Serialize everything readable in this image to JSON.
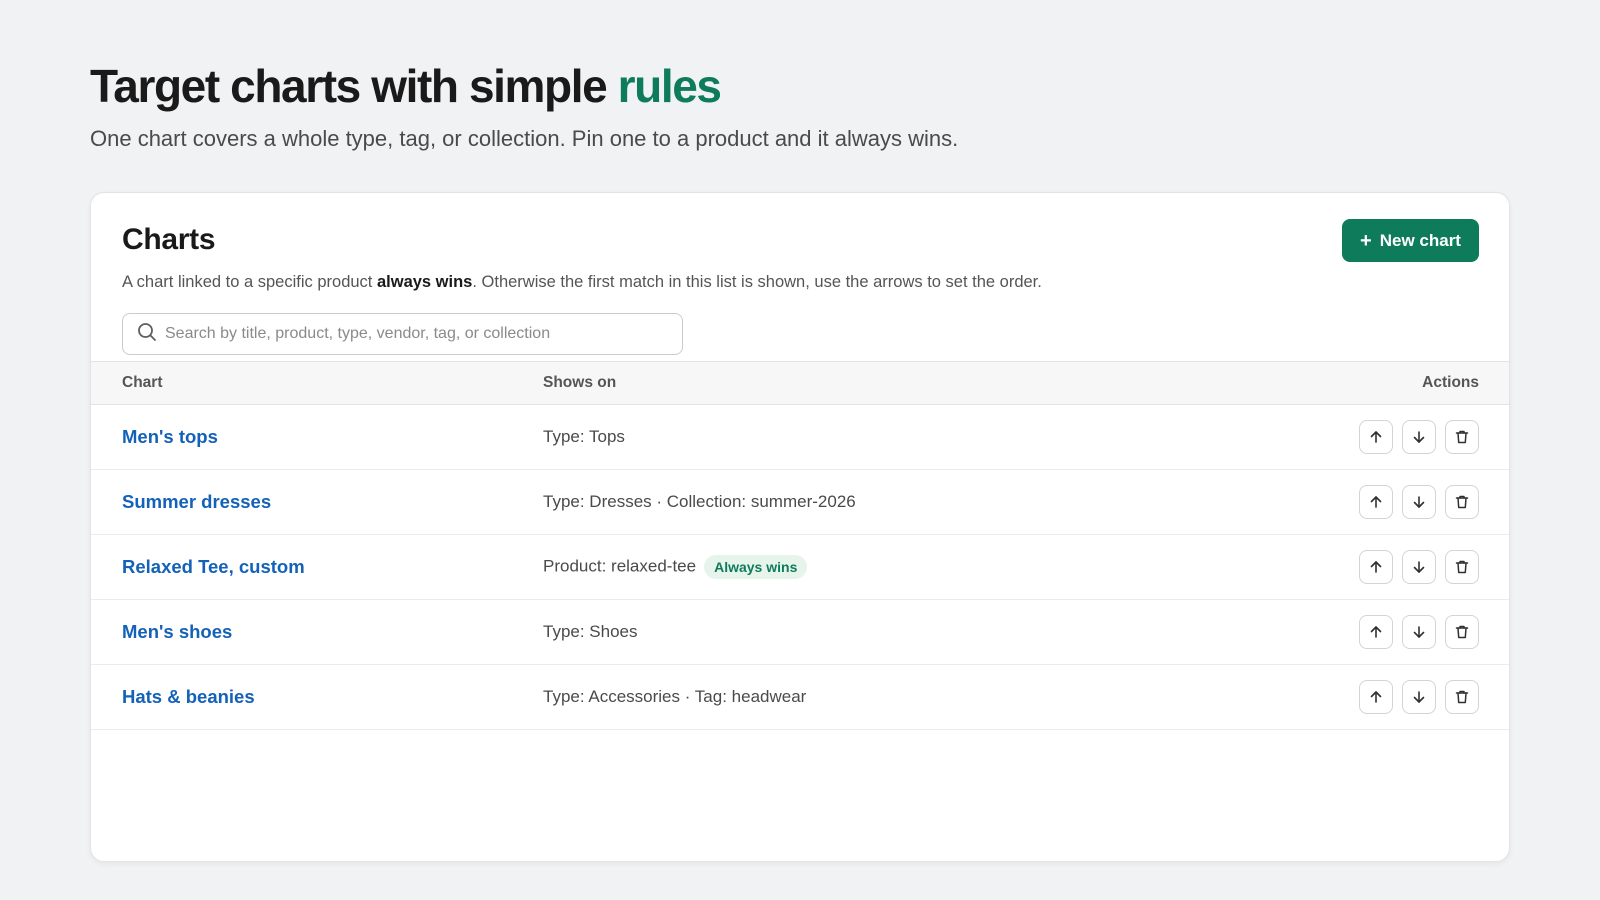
{
  "hero": {
    "title_main": "Target charts with simple ",
    "title_accent": "rules",
    "subtitle": "One chart covers a whole type, tag, or collection. Pin one to a product and it always wins."
  },
  "card": {
    "title": "Charts",
    "desc_before": "A chart linked to a specific product ",
    "desc_bold": "always wins",
    "desc_after": ". Otherwise the first match in this list is shown, use the arrows to set the order.",
    "new_button": "New chart"
  },
  "search": {
    "placeholder": "Search by title, product, type, vendor, tag, or collection",
    "value": ""
  },
  "table": {
    "headers": [
      "Chart",
      "Shows on",
      "Actions"
    ],
    "rows": [
      {
        "name": "Men's tops",
        "shows_on": "Type: Tops",
        "badge": ""
      },
      {
        "name": "Summer dresses",
        "shows_on": "Type: Dresses · Collection: summer-2026",
        "badge": ""
      },
      {
        "name": "Relaxed Tee, custom",
        "shows_on": "Product: relaxed-tee",
        "badge": "Always wins"
      },
      {
        "name": "Men's shoes",
        "shows_on": "Type: Shoes",
        "badge": ""
      },
      {
        "name": "Hats & beanies",
        "shows_on": "Type: Accessories · Tag: headwear",
        "badge": ""
      }
    ]
  },
  "icons": [
    "search-icon",
    "plus-icon",
    "arrow-up-icon",
    "arrow-down-icon",
    "trash-icon"
  ],
  "colors": {
    "accent": "#0e7c5a",
    "link": "#1361b8",
    "badge_bg": "#e6f4ec"
  }
}
